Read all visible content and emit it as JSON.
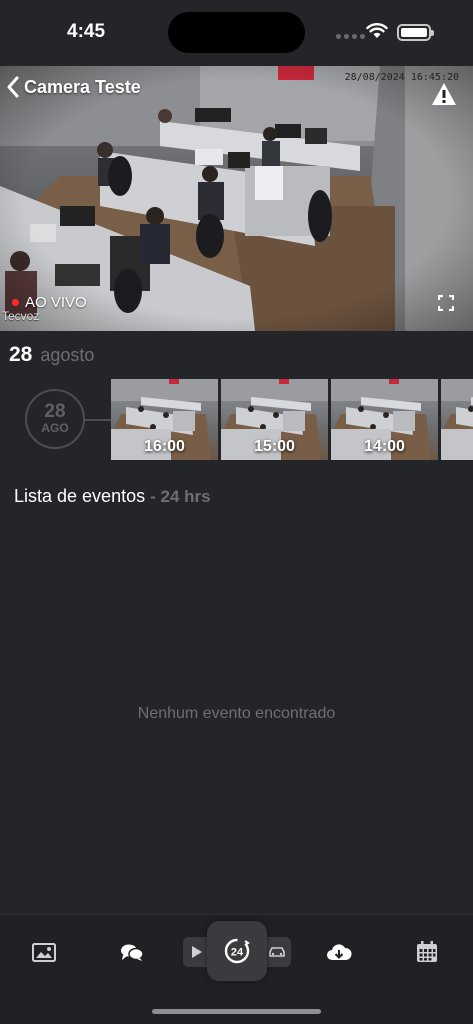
{
  "status_bar": {
    "time": "4:45"
  },
  "camera": {
    "title": "Camera Teste",
    "timestamp": "28/08/2024 16:45:20",
    "live_label": "AO VIVO",
    "watermark": "Tecvoz"
  },
  "day_header": {
    "day": "28",
    "month": "agosto"
  },
  "timeline": {
    "date_day": "28",
    "date_month": "AGO",
    "thumbnails": [
      {
        "label": "16:00"
      },
      {
        "label": "15:00"
      },
      {
        "label": "14:00"
      },
      {
        "label": ""
      }
    ]
  },
  "events": {
    "title": "Lista de eventos",
    "subtitle": "- 24 hrs",
    "empty_message": "Nenhum evento encontrado"
  },
  "bottom_bar": {
    "icons": [
      "image-icon",
      "chat-icon",
      "play-icon",
      "24h-icon",
      "car-icon",
      "cloud-download-icon",
      "calendar-icon"
    ]
  },
  "colors": {
    "background": "#242529",
    "live_dot": "#ff2a2a",
    "muted_text": "#6e6f73",
    "bottom_bar": "#202124"
  }
}
